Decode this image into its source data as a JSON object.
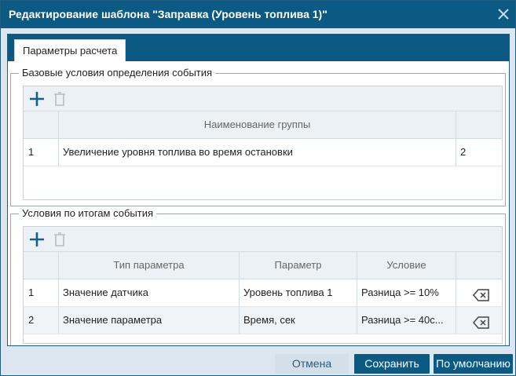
{
  "dialog": {
    "title": "Редактирование шаблона \"Заправка (Уровень топлива 1)\"",
    "tab_label": "Параметры расчета"
  },
  "base_conditions": {
    "legend": "Базовые условия определения события",
    "columns": [
      "Наименование группы"
    ],
    "rows": [
      {
        "num": "1",
        "name": "Увеличение уровня топлива во время остановки",
        "count": "2"
      }
    ]
  },
  "result_conditions": {
    "legend": "Условия по итогам события",
    "columns": [
      "Тип параметра",
      "Параметр",
      "Условие"
    ],
    "rows": [
      {
        "num": "1",
        "type": "Значение датчика",
        "param": "Уровень топлива 1",
        "condition": "Разница >= 10%"
      },
      {
        "num": "2",
        "type": "Значение параметра",
        "param": "Время, сек",
        "condition": "Разница >= 40с..."
      }
    ]
  },
  "footer": {
    "cancel": "Отмена",
    "save": "Сохранить",
    "default": "По умолчанию"
  },
  "colors": {
    "accent": "#0a5a83",
    "header_bg": "#ebf1f5"
  }
}
